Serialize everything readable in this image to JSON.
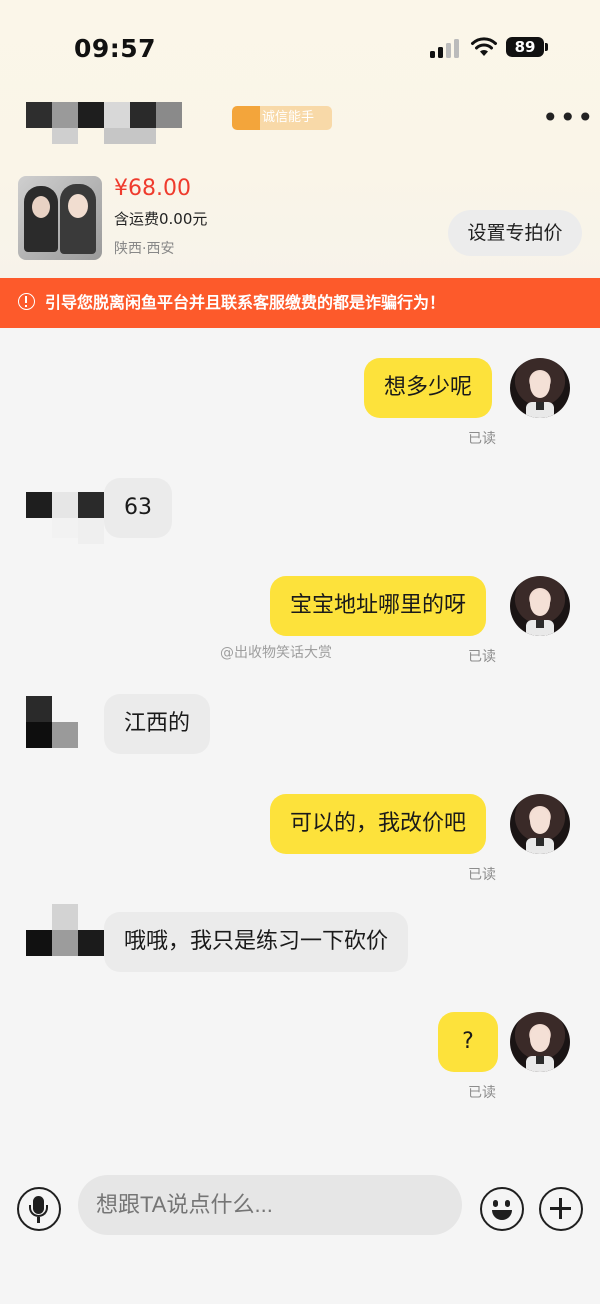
{
  "status_bar": {
    "time": "09:57",
    "battery": "89"
  },
  "header": {
    "tag": "诚信能手"
  },
  "product": {
    "price": "¥68.00",
    "shipping": "含运费0.00元",
    "location": "陕西·西安",
    "set_price_label": "设置专拍价"
  },
  "warning": {
    "text": "引导您脱离闲鱼平台并且联系客服缴费的都是诈骗行为！"
  },
  "messages": [
    {
      "from": "me",
      "text": "想多少呢",
      "status": "已读"
    },
    {
      "from": "other",
      "text": "63"
    },
    {
      "from": "me",
      "text": "宝宝地址哪里的呀",
      "status": "已读"
    },
    {
      "from": "other",
      "text": "江西的"
    },
    {
      "from": "me",
      "text": "可以的，我改价吧",
      "status": "已读"
    },
    {
      "from": "other",
      "text": "哦哦，我只是练习一下砍价"
    },
    {
      "from": "me",
      "text": "?",
      "status": "已读"
    }
  ],
  "watermark": "@出收物笑话大赏",
  "input": {
    "placeholder": "想跟TA说点什么..."
  },
  "icons": {
    "more": "more-icon",
    "mic": "microphone-icon",
    "emoji": "emoji-icon",
    "plus": "plus-icon",
    "warning": "exclamation-circle-icon",
    "signal": "signal-icon",
    "wifi": "wifi-icon",
    "battery": "battery-icon"
  },
  "colors": {
    "my_bubble": "#fde23b",
    "other_bubble": "#ebebeb",
    "warning_bg": "#fd5a2b",
    "price": "#ef3b2d"
  }
}
